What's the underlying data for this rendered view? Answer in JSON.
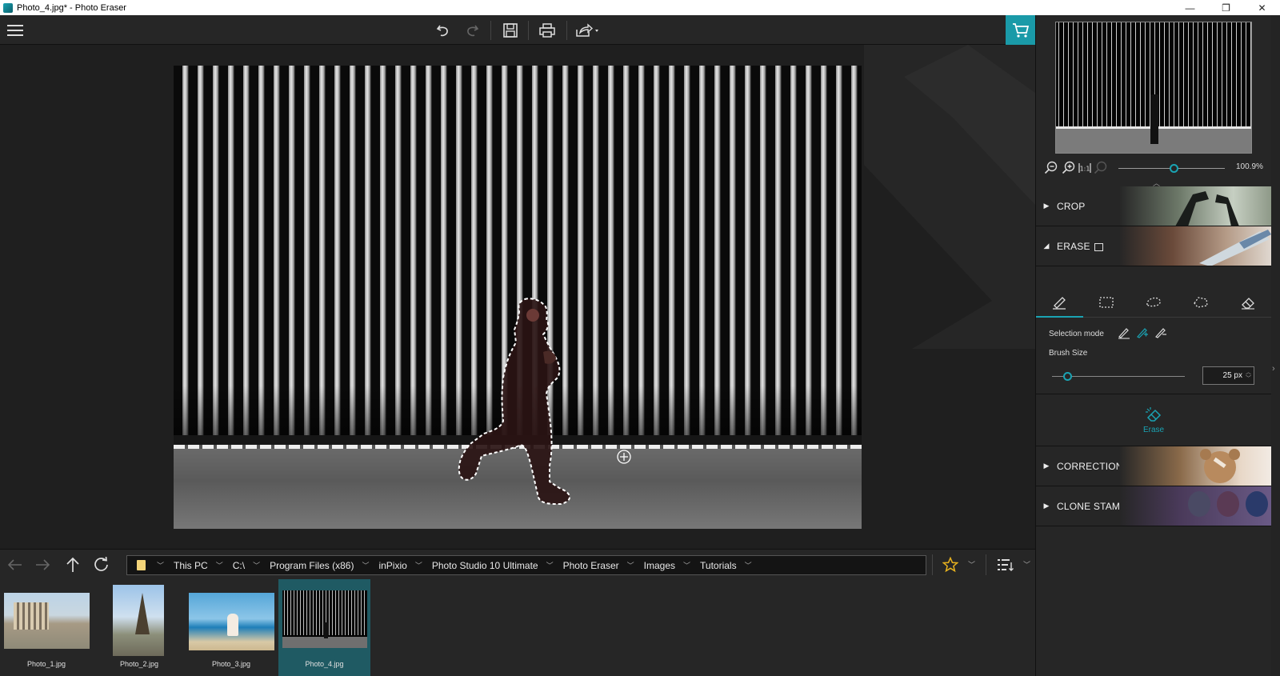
{
  "window": {
    "title": "Photo_4.jpg* - Photo Eraser",
    "controls": [
      "—",
      "❐",
      "✕"
    ]
  },
  "toolbar": {
    "undo": "undo",
    "redo": "redo",
    "save": "save",
    "print": "print",
    "share": "share",
    "cart": "cart"
  },
  "path": {
    "crumbs": [
      "This PC",
      "C:\\",
      "Program Files (x86)",
      "inPixio",
      "Photo Studio 10 Ultimate",
      "Photo Eraser",
      "Images",
      "Tutorials"
    ]
  },
  "thumbnails": [
    {
      "name": "Photo_1.jpg",
      "selected": false
    },
    {
      "name": "Photo_2.jpg",
      "selected": false
    },
    {
      "name": "Photo_3.jpg",
      "selected": false
    },
    {
      "name": "Photo_4.jpg",
      "selected": true
    }
  ],
  "panel": {
    "zoom": "100.9%",
    "sections": {
      "crop": "CROP",
      "erase": "ERASE",
      "correction": "CORRECTION PATCH",
      "clone": "CLONE STAMP"
    },
    "selection_mode_label": "Selection mode",
    "brush_size_label": "Brush Size",
    "brush_size_value": "25 px",
    "erase_button": "Erase"
  },
  "colors": {
    "accent": "#1aa3b3",
    "selected_thumb": "#1f5a63"
  }
}
